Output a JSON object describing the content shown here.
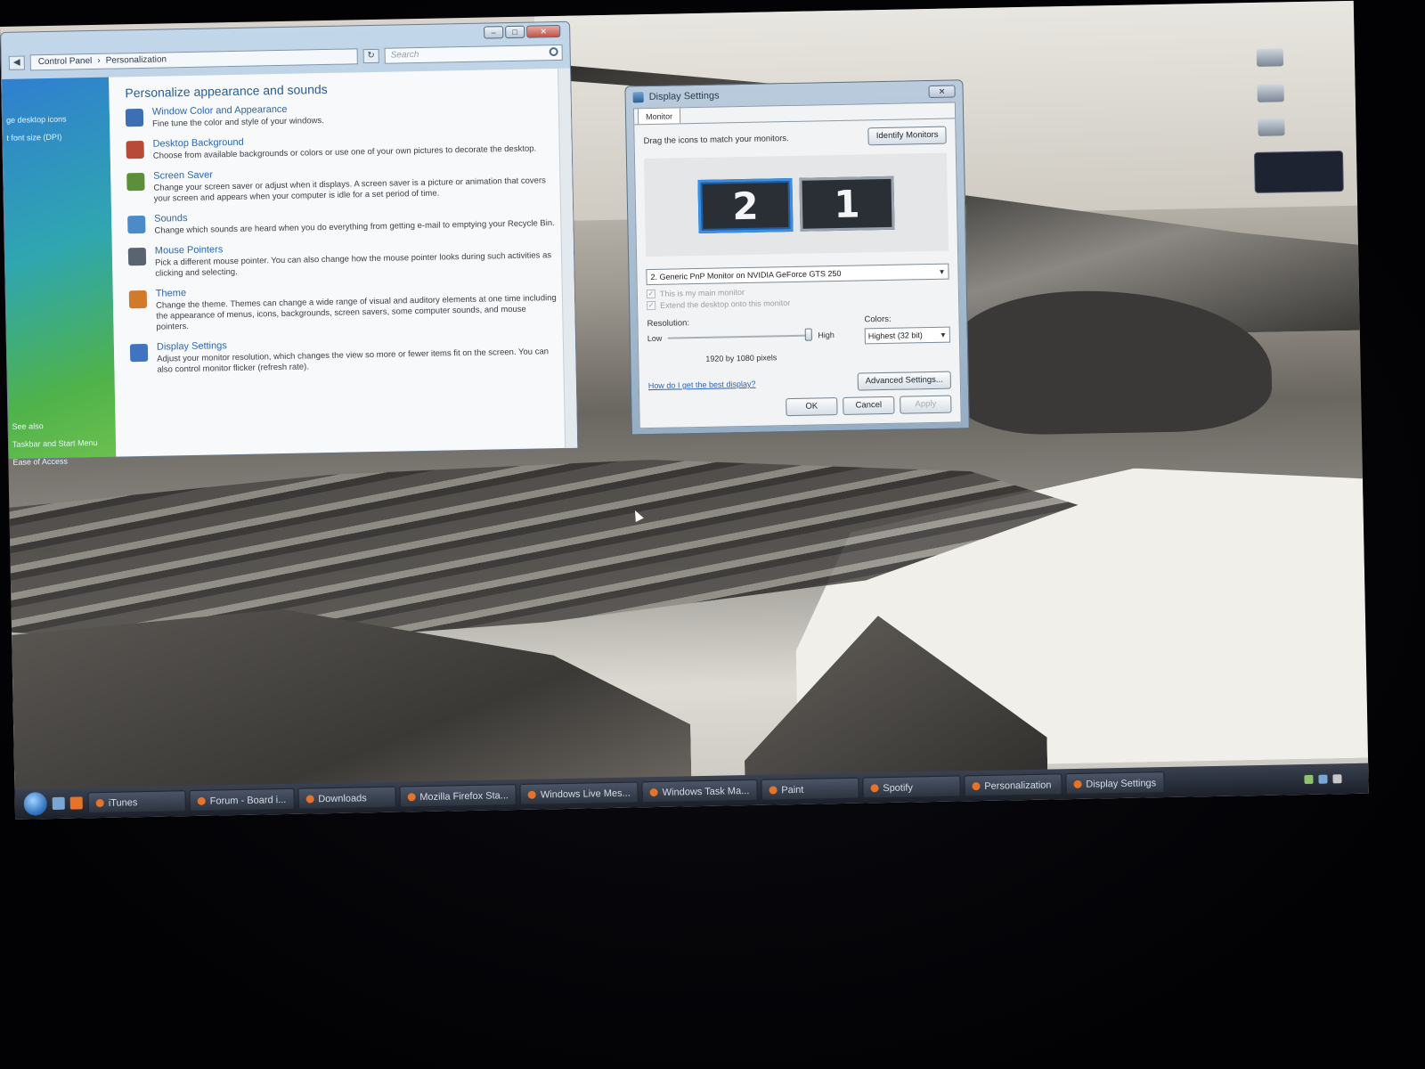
{
  "control_panel": {
    "breadcrumb": [
      "Control Panel",
      "Personalization"
    ],
    "search_placeholder": "Search",
    "left_tasks": [
      "ge desktop icons",
      "t font size (DPI)"
    ],
    "see_also": {
      "title": "See also",
      "links": [
        "Taskbar and Start Menu",
        "Ease of Access"
      ]
    },
    "heading": "Personalize appearance and sounds",
    "items": [
      {
        "title": "Window Color and Appearance",
        "desc": "Fine tune the color and style of your windows.",
        "icon": "window-color-icon",
        "color": "#3d6fb5"
      },
      {
        "title": "Desktop Background",
        "desc": "Choose from available backgrounds or colors or use one of your own pictures to decorate the desktop.",
        "icon": "desktop-background-icon",
        "color": "#b84a3a"
      },
      {
        "title": "Screen Saver",
        "desc": "Change your screen saver or adjust when it displays. A screen saver is a picture or animation that covers your screen and appears when your computer is idle for a set period of time.",
        "icon": "screen-saver-icon",
        "color": "#5b8f3a"
      },
      {
        "title": "Sounds",
        "desc": "Change which sounds are heard when you do everything from getting e-mail to emptying your Recycle Bin.",
        "icon": "sounds-icon",
        "color": "#4a8bc8"
      },
      {
        "title": "Mouse Pointers",
        "desc": "Pick a different mouse pointer. You can also change how the mouse pointer looks during such activities as clicking and selecting.",
        "icon": "mouse-pointer-icon",
        "color": "#5a6470"
      },
      {
        "title": "Theme",
        "desc": "Change the theme. Themes can change a wide range of visual and auditory elements at one time including the appearance of menus, icons, backgrounds, screen savers, some computer sounds, and mouse pointers.",
        "icon": "theme-icon",
        "color": "#d27a2c"
      },
      {
        "title": "Display Settings",
        "desc": "Adjust your monitor resolution, which changes the view so more or fewer items fit on the screen. You can also control monitor flicker (refresh rate).",
        "icon": "display-settings-icon",
        "color": "#3f74c0"
      }
    ]
  },
  "display_settings": {
    "title": "Display Settings",
    "tab": "Monitor",
    "instruction": "Drag the icons to match your monitors.",
    "identify_button": "Identify Monitors",
    "monitors": [
      {
        "label": "2",
        "selected": true
      },
      {
        "label": "1",
        "selected": false
      }
    ],
    "monitor_select": "2. Generic PnP Monitor on NVIDIA GeForce GTS 250",
    "checkboxes": [
      {
        "label": "This is my main monitor",
        "checked": true
      },
      {
        "label": "Extend the desktop onto this monitor",
        "checked": true
      }
    ],
    "resolution_label": "Resolution:",
    "low_label": "Low",
    "high_label": "High",
    "resolution_level": 1.0,
    "resolution_value": "1920 by 1080 pixels",
    "colors_label": "Colors:",
    "colors_value": "Highest (32 bit)",
    "help_link": "How do I get the best display?",
    "advanced_button": "Advanced Settings...",
    "ok": "OK",
    "cancel": "Cancel",
    "apply": "Apply"
  },
  "taskbar": {
    "items": [
      "iTunes",
      "Forum - Board i...",
      "Downloads",
      "Mozilla Firefox Sta...",
      "Windows Live Mes...",
      "Windows Task Ma...",
      "Paint",
      "Spotify",
      "Personalization",
      "Display Settings"
    ]
  }
}
